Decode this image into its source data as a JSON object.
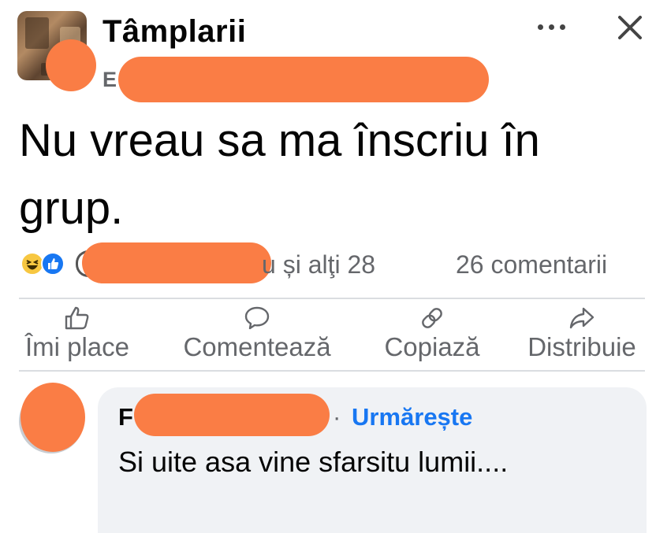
{
  "header": {
    "group_name": "Tâmplarii",
    "author_visible_initial": "E"
  },
  "post": {
    "text": "Nu vreau sa ma înscriu în grup."
  },
  "reactions": {
    "types": [
      "haha",
      "like"
    ],
    "summary_suffix": "u și alţi 28",
    "comments_count": "26 comentarii"
  },
  "actions": {
    "like": "Îmi place",
    "comment": "Comentează",
    "copy": "Copiază",
    "share": "Distribuie"
  },
  "comment": {
    "author_visible_initial": "F",
    "separator": "·",
    "follow_label": "Urmărește",
    "text": "Si uite asa vine sfarsitu lumii...."
  },
  "colors": {
    "redaction": "#fa7d45",
    "accent": "#1877f2",
    "secondary_text": "#65676b",
    "bubble": "#f0f2f5"
  }
}
